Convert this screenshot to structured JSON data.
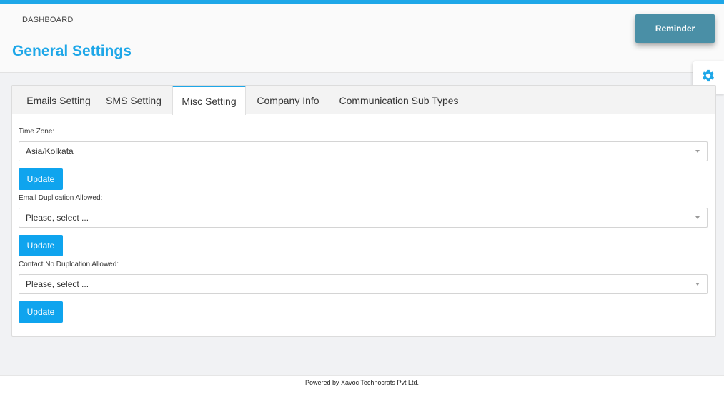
{
  "header": {
    "breadcrumb": "DASHBOARD",
    "title": "General Settings",
    "reminder_label": "Reminder"
  },
  "icons": {
    "settings": "gear-icon"
  },
  "colors": {
    "accent": "#1ea7e8",
    "button": "#0fa4ee",
    "reminder": "#4a8fa6"
  },
  "tabs": [
    {
      "label": "Emails Setting",
      "active": false
    },
    {
      "label": "SMS Setting",
      "active": false
    },
    {
      "label": "Misc Setting",
      "active": true
    },
    {
      "label": "Company Info",
      "active": false
    },
    {
      "label": "Communication Sub Types",
      "active": false
    }
  ],
  "form": {
    "timezone": {
      "label": "Time Zone:",
      "value": "Asia/Kolkata",
      "button": "Update"
    },
    "email_dup": {
      "label": "Email Duplication Allowed:",
      "value": "Please, select ...",
      "button": "Update"
    },
    "contact_dup": {
      "label": "Contact No Duplcation Allowed:",
      "value": "Please, select ...",
      "button": "Update"
    }
  },
  "footer": {
    "text": "Powered by Xavoc Technocrats Pvt Ltd."
  }
}
